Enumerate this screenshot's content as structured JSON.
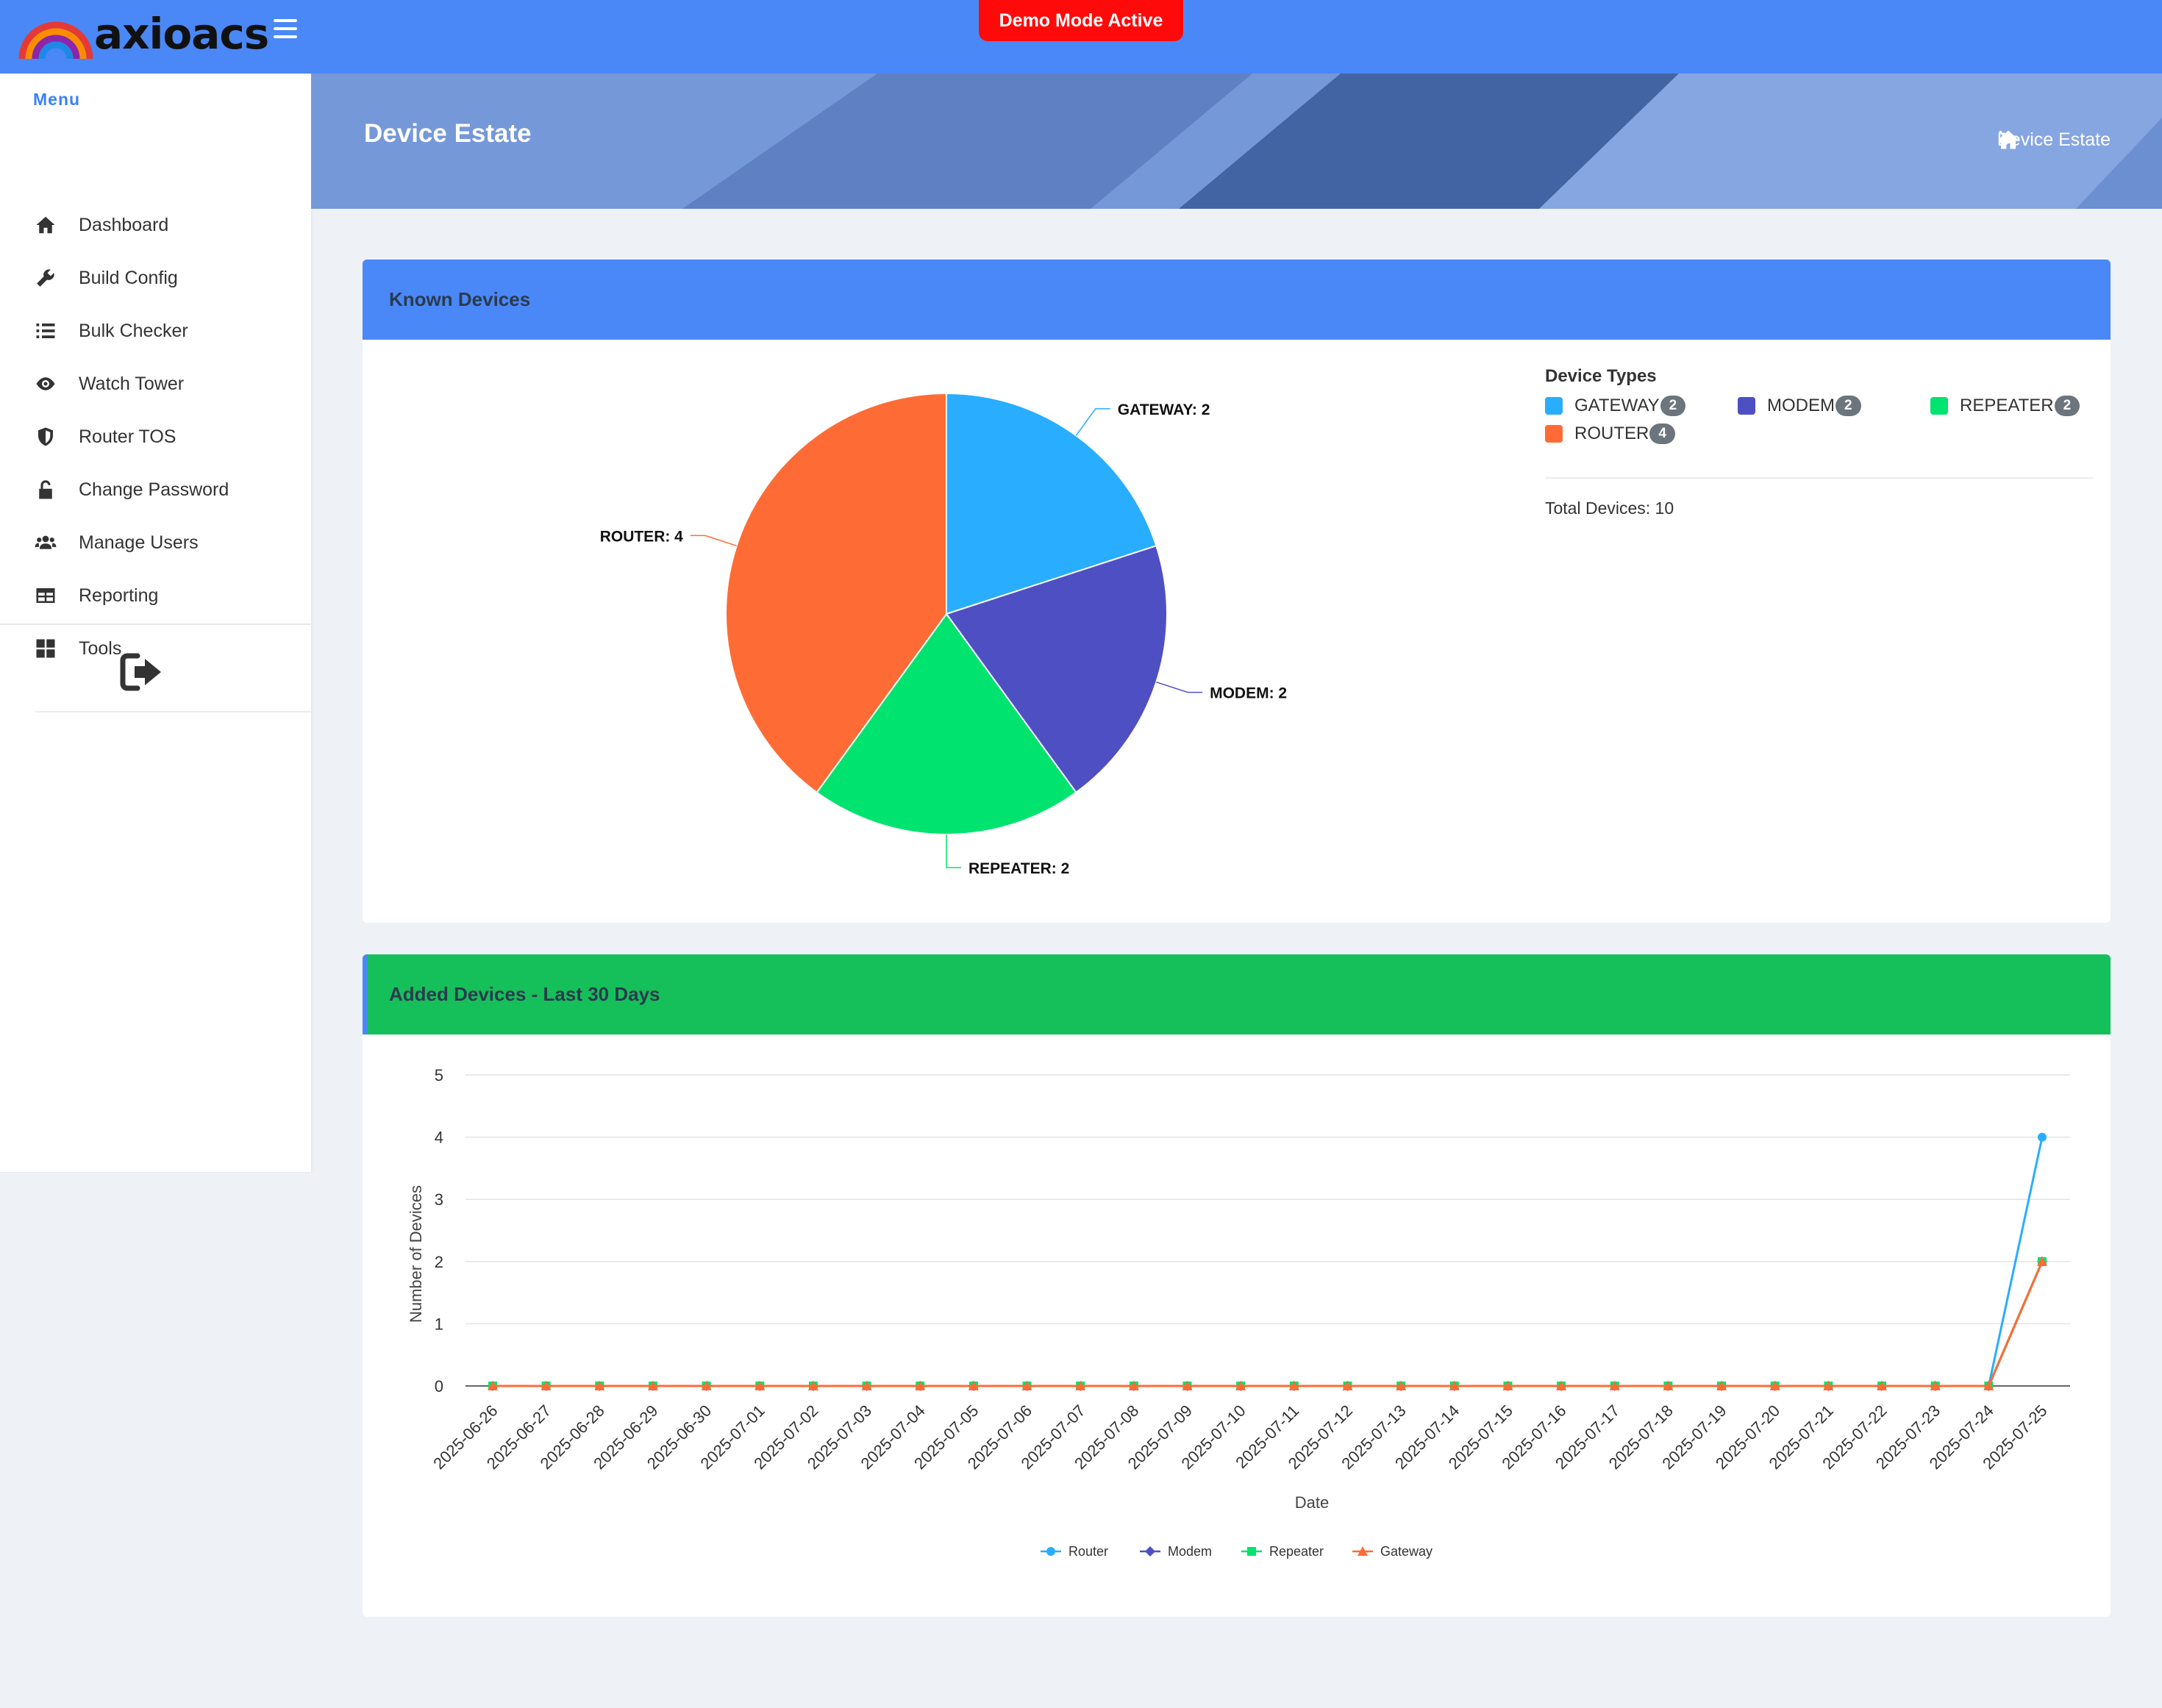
{
  "brand": {
    "name": "axioacs"
  },
  "demo_badge": "Demo Mode Active",
  "sidebar": {
    "menu_title": "Menu",
    "items": [
      {
        "label": "Dashboard",
        "icon": "home-icon"
      },
      {
        "label": "Build Config",
        "icon": "wrench-icon"
      },
      {
        "label": "Bulk Checker",
        "icon": "list-icon"
      },
      {
        "label": "Watch Tower",
        "icon": "eye-icon"
      },
      {
        "label": "Router TOS",
        "icon": "shield-icon"
      },
      {
        "label": "Change Password",
        "icon": "unlock-icon"
      },
      {
        "label": "Manage Users",
        "icon": "users-icon"
      },
      {
        "label": "Reporting",
        "icon": "table-icon"
      },
      {
        "label": "Tools",
        "icon": "grid-icon"
      }
    ],
    "logout_icon": "logout-icon"
  },
  "page": {
    "title": "Device Estate",
    "breadcrumb": [
      "Device Estate"
    ]
  },
  "colors": {
    "router": "#ff6b35",
    "modem": "#4f4fc4",
    "repeater": "#00e36e",
    "gateway": "#29adff",
    "topbar": "#4a88f7",
    "card2_header": "#15c05a",
    "demo_badge": "#ff0a0a"
  },
  "known_devices": {
    "title": "Known Devices",
    "legend_title": "Device Types",
    "types": [
      {
        "name": "GATEWAY",
        "count": "2",
        "color": "#29adff"
      },
      {
        "name": "MODEM",
        "count": "2",
        "color": "#4f4fc4"
      },
      {
        "name": "REPEATER",
        "count": "2",
        "color": "#00e36e"
      },
      {
        "name": "ROUTER",
        "count": "4",
        "color": "#ff6b35"
      }
    ],
    "total_label": "Total Devices: 10"
  },
  "added_devices": {
    "title": "Added Devices - Last 30 Days"
  },
  "chart_data": [
    {
      "type": "pie",
      "title": "",
      "slices": [
        {
          "label": "GATEWAY",
          "value": 2,
          "data_label": "GATEWAY: 2",
          "color": "#29adff"
        },
        {
          "label": "MODEM",
          "value": 2,
          "data_label": "MODEM: 2",
          "color": "#4f4fc4"
        },
        {
          "label": "REPEATER",
          "value": 2,
          "data_label": "REPEATER: 2",
          "color": "#00e36e"
        },
        {
          "label": "ROUTER",
          "value": 4,
          "data_label": "ROUTER: 4",
          "color": "#ff6b35"
        }
      ]
    },
    {
      "type": "line",
      "title": "",
      "xlabel": "Date",
      "ylabel": "Number of Devices",
      "ylim": [
        0,
        5
      ],
      "yticks": [
        0,
        1,
        2,
        3,
        4,
        5
      ],
      "grid": true,
      "legend_position": "bottom-center",
      "x": [
        "2025-06-26",
        "2025-06-27",
        "2025-06-28",
        "2025-06-29",
        "2025-06-30",
        "2025-07-01",
        "2025-07-02",
        "2025-07-03",
        "2025-07-04",
        "2025-07-05",
        "2025-07-06",
        "2025-07-07",
        "2025-07-08",
        "2025-07-09",
        "2025-07-10",
        "2025-07-11",
        "2025-07-12",
        "2025-07-13",
        "2025-07-14",
        "2025-07-15",
        "2025-07-16",
        "2025-07-17",
        "2025-07-18",
        "2025-07-19",
        "2025-07-20",
        "2025-07-21",
        "2025-07-22",
        "2025-07-23",
        "2025-07-24",
        "2025-07-25"
      ],
      "series": [
        {
          "name": "Router",
          "color": "#29adff",
          "marker": "circle",
          "values": [
            0,
            0,
            0,
            0,
            0,
            0,
            0,
            0,
            0,
            0,
            0,
            0,
            0,
            0,
            0,
            0,
            0,
            0,
            0,
            0,
            0,
            0,
            0,
            0,
            0,
            0,
            0,
            0,
            0,
            4
          ]
        },
        {
          "name": "Modem",
          "color": "#4f4fc4",
          "marker": "diamond",
          "values": [
            0,
            0,
            0,
            0,
            0,
            0,
            0,
            0,
            0,
            0,
            0,
            0,
            0,
            0,
            0,
            0,
            0,
            0,
            0,
            0,
            0,
            0,
            0,
            0,
            0,
            0,
            0,
            0,
            0,
            2
          ]
        },
        {
          "name": "Repeater",
          "color": "#00e36e",
          "marker": "square",
          "values": [
            0,
            0,
            0,
            0,
            0,
            0,
            0,
            0,
            0,
            0,
            0,
            0,
            0,
            0,
            0,
            0,
            0,
            0,
            0,
            0,
            0,
            0,
            0,
            0,
            0,
            0,
            0,
            0,
            0,
            2
          ]
        },
        {
          "name": "Gateway",
          "color": "#ff6b35",
          "marker": "triangle",
          "values": [
            0,
            0,
            0,
            0,
            0,
            0,
            0,
            0,
            0,
            0,
            0,
            0,
            0,
            0,
            0,
            0,
            0,
            0,
            0,
            0,
            0,
            0,
            0,
            0,
            0,
            0,
            0,
            0,
            0,
            2
          ]
        }
      ]
    }
  ]
}
